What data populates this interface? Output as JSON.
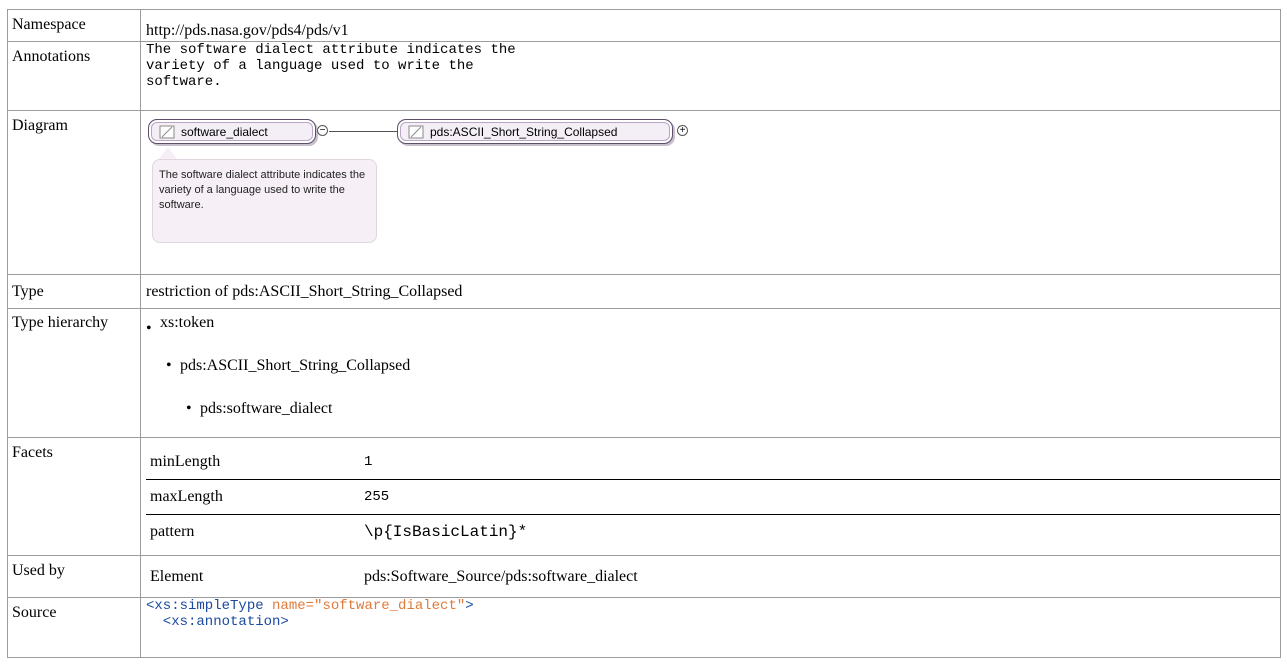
{
  "rows": {
    "namespace": {
      "label": "Namespace",
      "value": "http://pds.nasa.gov/pds4/pds/v1"
    },
    "annotations": {
      "label": "Annotations",
      "value": "The software dialect attribute indicates the\nvariety of a language used to write the\nsoftware."
    },
    "diagram": {
      "label": "Diagram",
      "element_node": "software_dialect",
      "type_node": "pds:ASCII_Short_String_Collapsed",
      "collapse_symbol": "−",
      "expand_symbol": "+",
      "tooltip": "The software dialect attribute indicates the variety of a language used to write the software."
    },
    "type": {
      "label": "Type",
      "value": "restriction of pds:ASCII_Short_String_Collapsed"
    },
    "type_hierarchy": {
      "label": "Type hierarchy",
      "items": [
        "xs:token",
        "pds:ASCII_Short_String_Collapsed",
        "pds:software_dialect"
      ]
    },
    "facets": {
      "label": "Facets",
      "items": [
        {
          "name": "minLength",
          "value": "1"
        },
        {
          "name": "maxLength",
          "value": "255"
        },
        {
          "name": "pattern",
          "value": "\\p{IsBasicLatin}*"
        }
      ]
    },
    "used_by": {
      "label": "Used by",
      "kind": "Element",
      "value": "pds:Software_Source/pds:software_dialect"
    },
    "source": {
      "label": "Source",
      "line1_tag_open": "<xs:simpleType",
      "line1_attr": "name=\"software_dialect\"",
      "line1_tag_close": ">",
      "line2": "  <xs:annotation>"
    }
  },
  "colors": {
    "border": "#9c9c9c",
    "node_fill": "#f4eef6",
    "tag": "#1a4aa0",
    "attr": "#e07a3a"
  }
}
